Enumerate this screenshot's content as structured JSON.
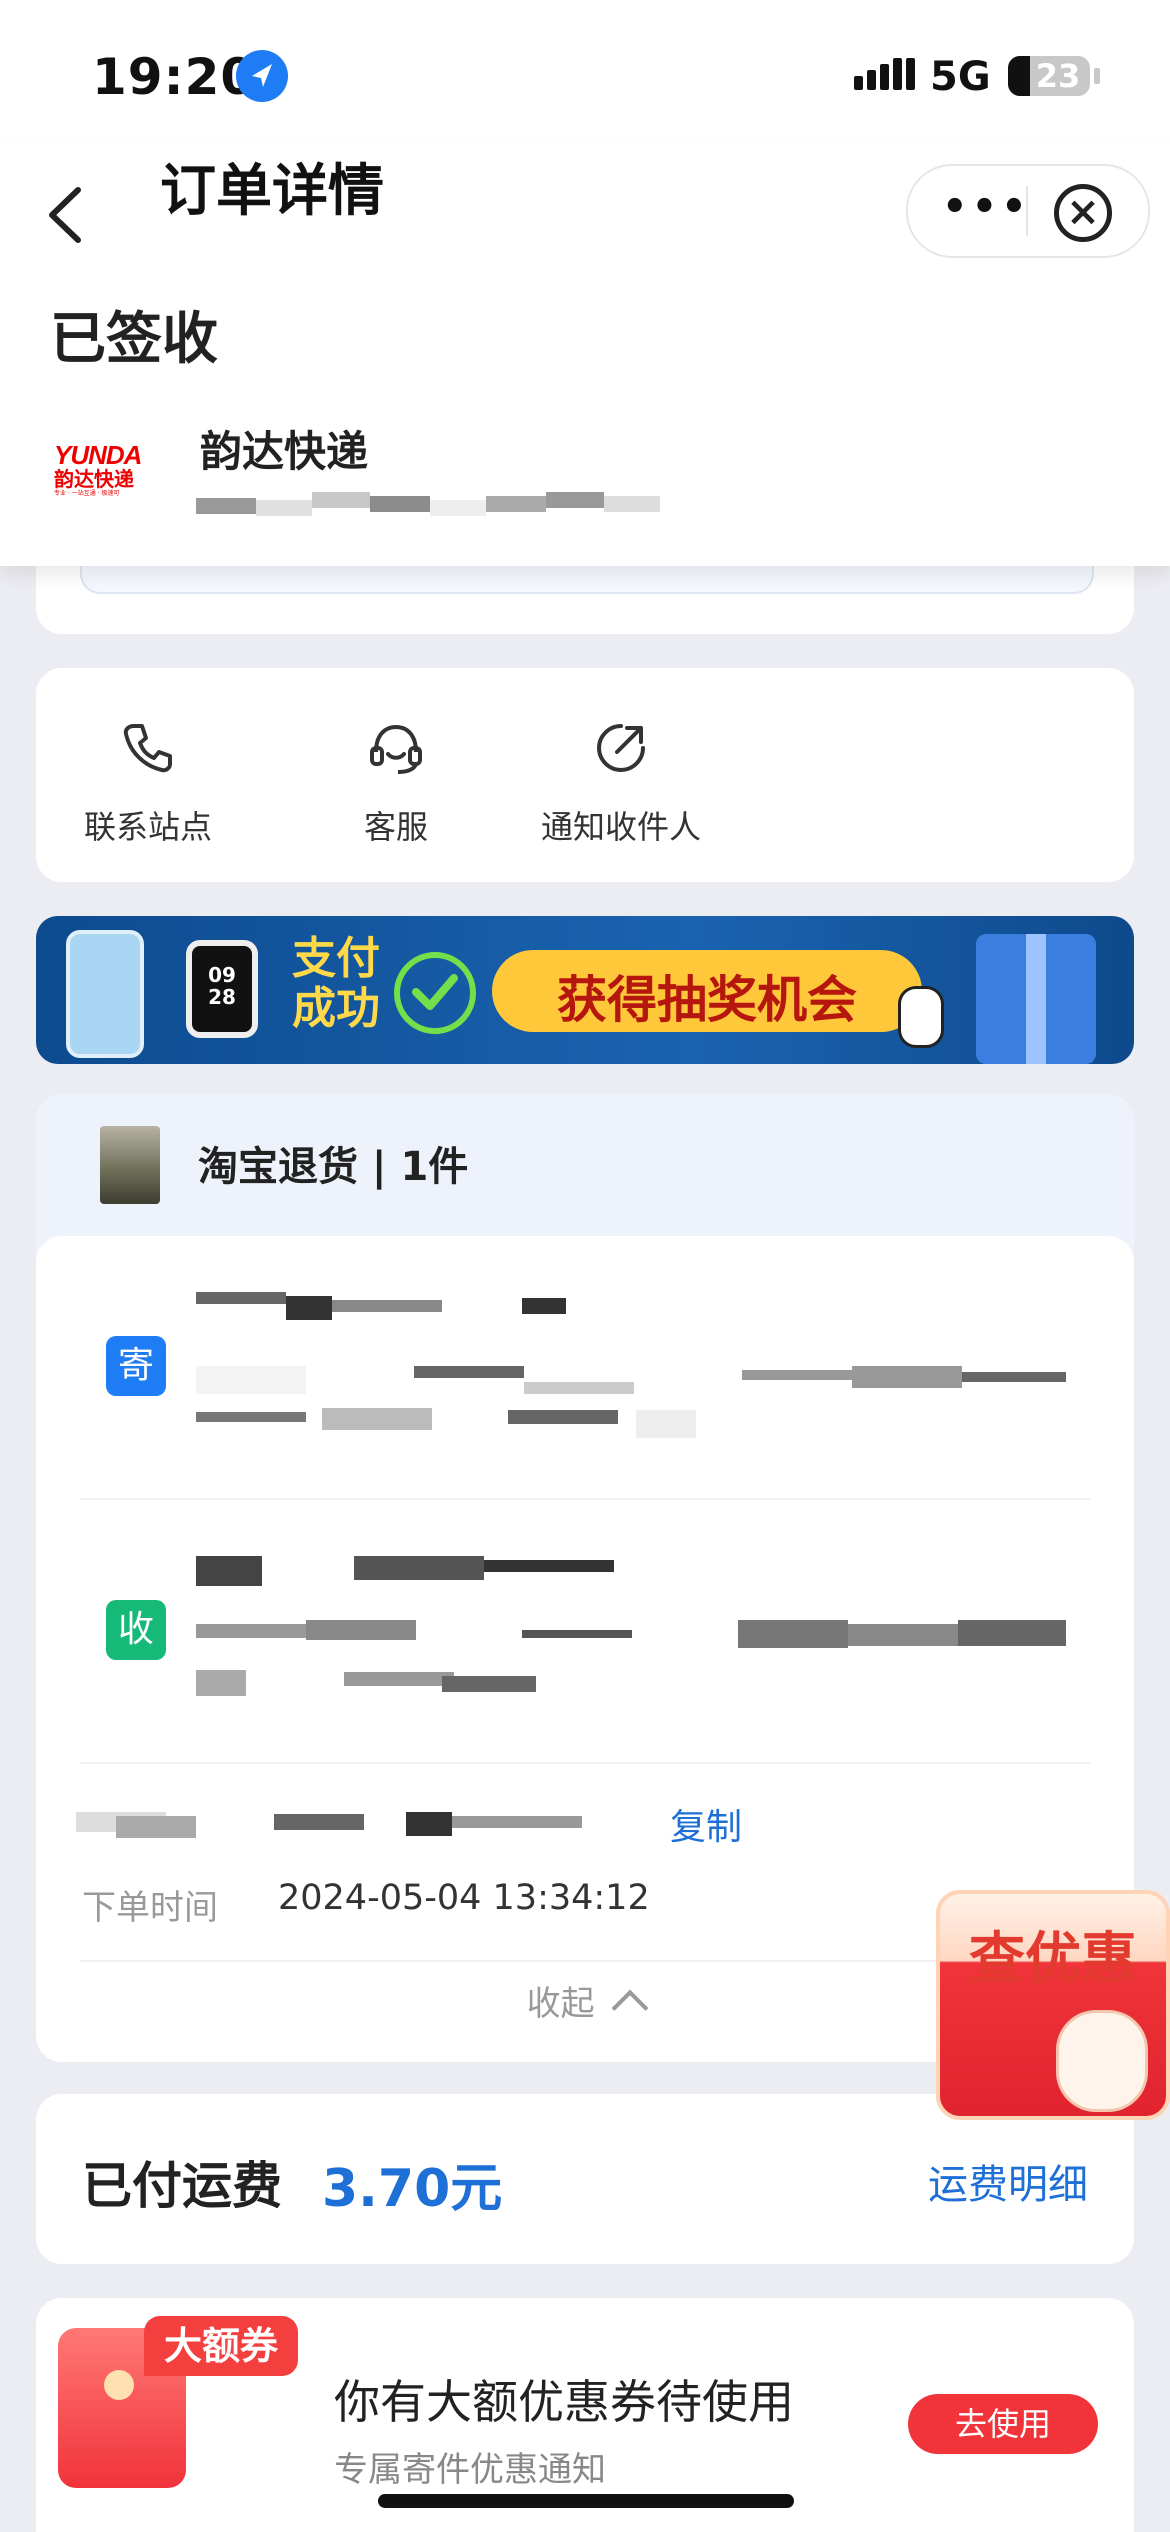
{
  "status_bar": {
    "time": "19:20",
    "network": "5G",
    "battery": "23"
  },
  "header": {
    "title": "订单详情"
  },
  "order_status": "已签收",
  "courier": {
    "name": "韵达快递",
    "logo_text": "YUNDA",
    "logo_cn": "韵达快递",
    "logo_slogan": "专业 · 一站互通 · 极速可"
  },
  "actions": [
    {
      "label": "联系站点",
      "icon": "phone-icon"
    },
    {
      "label": "客服",
      "icon": "headset-icon"
    },
    {
      "label": "通知收件人",
      "icon": "share-icon"
    }
  ],
  "banner": {
    "left_text_1": "支付",
    "left_text_2": "成功",
    "cta": "获得抽奖机会",
    "watch_time": "09 28"
  },
  "order": {
    "title": "淘宝退货 | 1件",
    "sender_tag": "寄",
    "receiver_tag": "收",
    "copy_label": "复制",
    "order_time_label": "下单时间",
    "order_time": "2024-05-04 13:34:12",
    "collapse_label": "收起"
  },
  "fee": {
    "label": "已付运费",
    "value": "3.70元",
    "detail_link": "运费明细"
  },
  "floating_promo": {
    "label": "查优惠"
  },
  "coupon": {
    "badge": "大额券",
    "title": "你有大额优惠券待使用",
    "subtitle": "专属寄件优惠通知",
    "button": "去使用"
  },
  "colors": {
    "accent_blue": "#1e6fd6",
    "sender_blue": "#1e7cf4",
    "receiver_green": "#17b978",
    "promo_red": "#f0343a"
  }
}
